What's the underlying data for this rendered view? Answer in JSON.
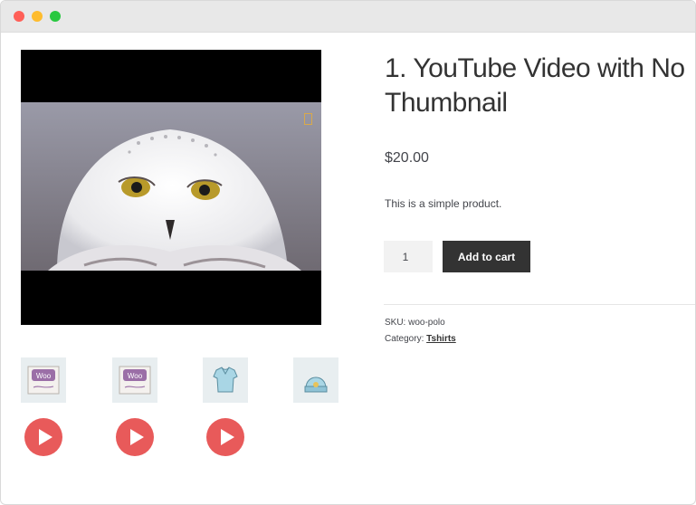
{
  "window": {
    "controls": [
      "close",
      "minimize",
      "maximize"
    ]
  },
  "gallery": {
    "main_media": "snowy-owl-video-frame",
    "thumbnails": [
      {
        "name": "woo-logo-thumbnail-1"
      },
      {
        "name": "woo-logo-thumbnail-2"
      },
      {
        "name": "tshirt-thumbnail"
      },
      {
        "name": "beanie-thumbnail"
      }
    ],
    "play_buttons": 3
  },
  "product": {
    "title": "1. YouTube Video with No Thumbnail",
    "price": "$20.00",
    "description": "This is a simple product.",
    "quantity": "1",
    "add_to_cart_label": "Add to cart",
    "sku_label": "SKU:",
    "sku_value": "woo-polo",
    "category_label": "Category:",
    "category_value": "Tshirts"
  },
  "colors": {
    "play_button": "#e85a5a",
    "add_to_cart_bg": "#333333",
    "qty_bg": "#f2f2f2"
  }
}
